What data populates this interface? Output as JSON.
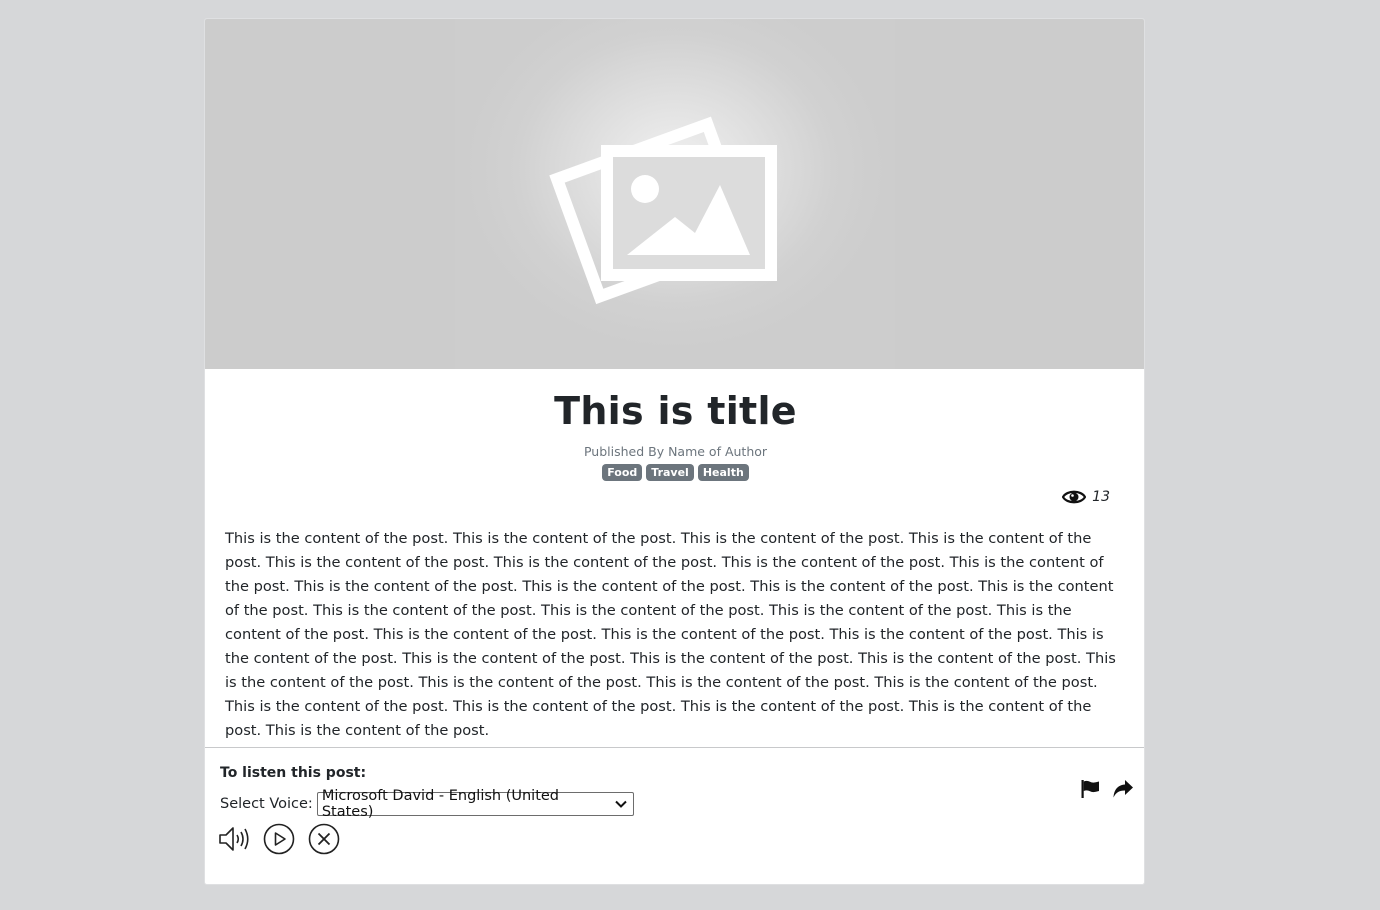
{
  "post": {
    "title": "This is title",
    "byline": "Published By Name of Author",
    "tags": [
      "Food",
      "Travel",
      "Health"
    ],
    "views": "13",
    "content": "This is the content of the post. This is the content of the post. This is the content of the post. This is the content of the post. This is the content of the post. This is the content of the post. This is the content of the post. This is the content of the post. This is the content of the post. This is the content of the post. This is the content of the post. This is the content of the post. This is the content of the post. This is the content of the post. This is the content of the post. This is the content of the post. This is the content of the post. This is the content of the post. This is the content of the post. This is the content of the post. This is the content of the post. This is the content of the post. This is the content of the post. This is the content of the post. This is the content of the post. This is the content of the post. This is the content of the post. This is the content of the post. This is the content of the post. This is the content of the post. This is the content of the post. This is the content of the post."
  },
  "listen": {
    "heading": "To listen this post:",
    "select_label": "Select Voice:",
    "selected_voice": "Microsoft David - English (United States)"
  },
  "icons": {
    "hero": "image-placeholder-icon",
    "views": "eye-icon",
    "select": "chevron-down-icon",
    "speaker": "speaker-icon",
    "play": "play-icon",
    "stop": "close-icon",
    "report": "flag-icon",
    "share": "share-icon"
  },
  "colors": {
    "tag_background": "#6c757d",
    "page_background": "#d6d7d9"
  }
}
